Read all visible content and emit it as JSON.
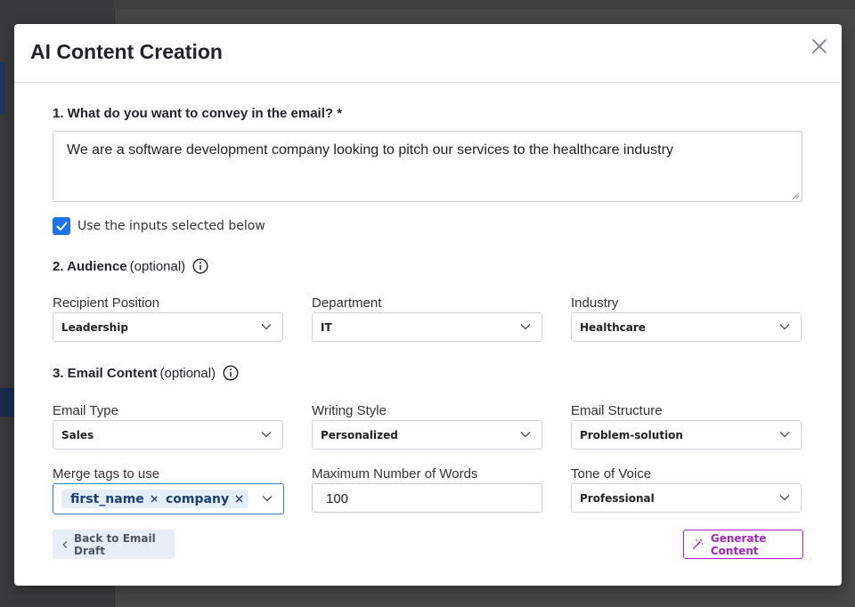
{
  "colors": {
    "accent": "#1a73e8",
    "generate": "#a623c4",
    "tag_bg": "#e4eefb"
  },
  "modal": {
    "title": "AI Content Creation"
  },
  "question1": {
    "label": "1. What do you want to convey in the email? *",
    "value": "We are a software development company looking to pitch our services to the healthcare industry"
  },
  "use_inputs": {
    "checked": true,
    "label": "Use the inputs selected below"
  },
  "audience": {
    "title": "2. Audience",
    "optional": "(optional)",
    "recipient_position": {
      "label": "Recipient Position",
      "value": "Leadership"
    },
    "department": {
      "label": "Department",
      "value": "IT"
    },
    "industry": {
      "label": "Industry",
      "value": "Healthcare"
    }
  },
  "content": {
    "title": "3. Email Content",
    "optional": "(optional)",
    "email_type": {
      "label": "Email Type",
      "value": "Sales"
    },
    "writing_style": {
      "label": "Writing Style",
      "value": "Personalized"
    },
    "email_structure": {
      "label": "Email Structure",
      "value": "Problem-solution"
    },
    "merge_tags": {
      "label": "Merge tags to use",
      "tags": [
        "first_name",
        "company"
      ]
    },
    "max_words": {
      "label": "Maximum Number of Words",
      "value": "100"
    },
    "tone": {
      "label": "Tone of Voice",
      "value": "Professional"
    }
  },
  "footer": {
    "back_label": "Back to Email Draft",
    "generate_label": "Generate Content"
  }
}
